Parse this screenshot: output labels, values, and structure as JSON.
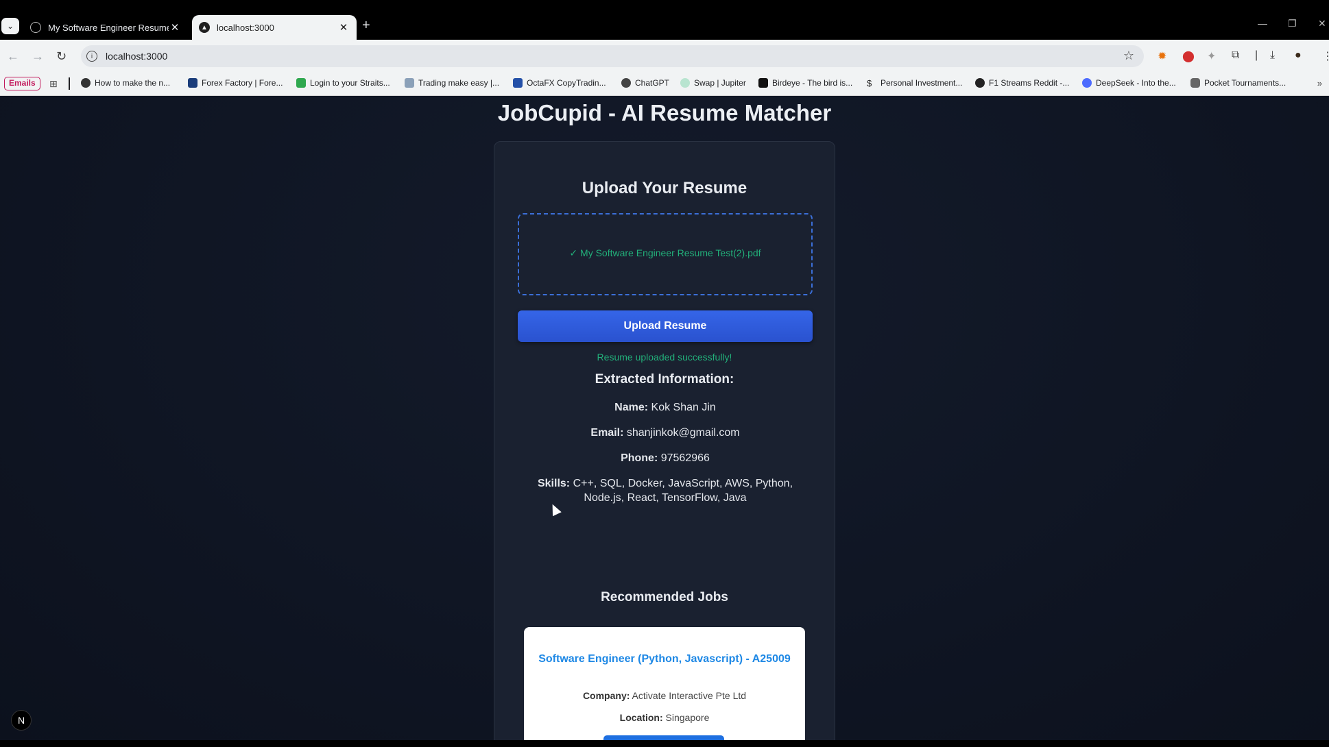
{
  "browser": {
    "tabs": [
      {
        "title": "My Software Engineer Resume",
        "active": false
      },
      {
        "title": "localhost:3000",
        "active": true
      }
    ],
    "url": "localhost:3000",
    "bookmarks": [
      {
        "label": "Emails"
      },
      {
        "label": "How to make the n..."
      },
      {
        "label": "Forex Factory | Fore..."
      },
      {
        "label": "Login to your Straits..."
      },
      {
        "label": "Trading make easy |..."
      },
      {
        "label": "OctaFX CopyTradin..."
      },
      {
        "label": "ChatGPT"
      },
      {
        "label": "Swap | Jupiter"
      },
      {
        "label": "Birdeye - The bird is..."
      },
      {
        "label": "Personal Investment..."
      },
      {
        "label": "F1 Streams Reddit -..."
      },
      {
        "label": "DeepSeek - Into the..."
      },
      {
        "label": "Pocket Tournaments..."
      }
    ]
  },
  "page": {
    "app_title": "JobCupid - AI Resume Matcher",
    "upload": {
      "heading": "Upload Your Resume",
      "file_status": "✓ My Software Engineer Resume Test(2).pdf",
      "button": "Upload Resume",
      "success_message": "Resume uploaded successfully!"
    },
    "extracted": {
      "heading": "Extracted Information:",
      "name_label": "Name:",
      "name": "Kok Shan Jin",
      "email_label": "Email:",
      "email": "shanjinkok@gmail.com",
      "phone_label": "Phone:",
      "phone": "97562966",
      "skills_label": "Skills:",
      "skills": "C++, SQL, Docker, JavaScript, AWS, Python, Node.js, React, TensorFlow, Java"
    },
    "recommended": {
      "heading": "Recommended Jobs",
      "jobs": [
        {
          "title": "Software Engineer (Python, Javascript) - A25009",
          "company_label": "Company:",
          "company": "Activate Interactive Pte Ltd",
          "location_label": "Location:",
          "location": "Singapore"
        }
      ]
    }
  },
  "overlay": {
    "badge": "N"
  },
  "colors": {
    "accent_blue": "#2a5bd7",
    "success_green": "#22b07a",
    "job_title_blue": "#1e88e5"
  }
}
